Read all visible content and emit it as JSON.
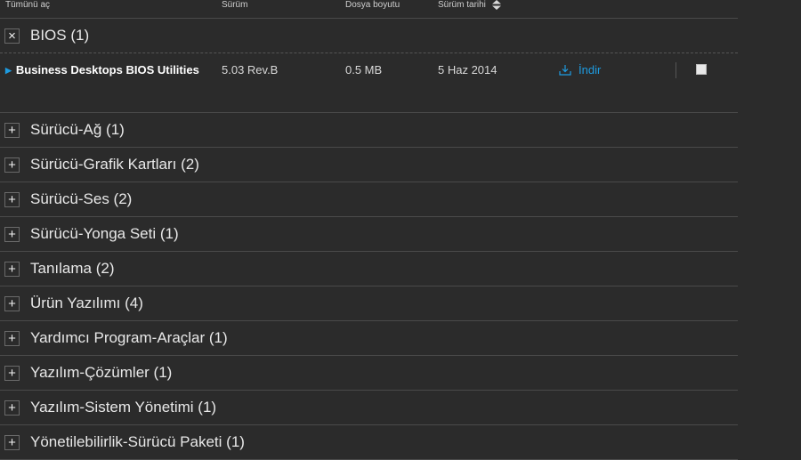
{
  "header": {
    "expand_all": "Tümünü aç",
    "version": "Sürüm",
    "file_size": "Dosya boyutu",
    "release_date": "Sürüm tarihi"
  },
  "bios": {
    "title": "BIOS (1)",
    "toggle": "×",
    "item": {
      "name": "Business Desktops BIOS Utilities",
      "version": "5.03 Rev.B",
      "size": "0.5 MB",
      "date": "5 Haz 2014",
      "download": "İndir"
    }
  },
  "categories": [
    "Sürücü-Ağ (1)",
    "Sürücü-Grafik Kartları (2)",
    "Sürücü-Ses (2)",
    "Sürücü-Yonga Seti (1)",
    "Tanılama (2)",
    "Ürün Yazılımı (4)",
    "Yardımcı Program-Araçlar (1)",
    "Yazılım-Çözümler (1)",
    "Yazılım-Sistem Yönetimi (1)",
    "Yönetilebilirlik-Sürücü Paketi (1)"
  ],
  "toggle_plus": "+",
  "colors": {
    "background": "#2b2b2b",
    "accent": "#1e9be0"
  }
}
